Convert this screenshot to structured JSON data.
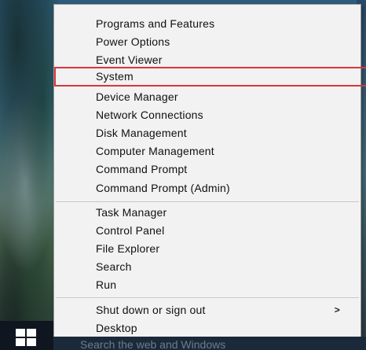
{
  "menu": {
    "items": [
      {
        "label": "Programs and Features"
      },
      {
        "label": "Power Options"
      },
      {
        "label": "Event Viewer"
      },
      {
        "label": "System"
      },
      {
        "label": "Device Manager"
      },
      {
        "label": "Network Connections"
      },
      {
        "label": "Disk Management"
      },
      {
        "label": "Computer Management"
      },
      {
        "label": "Command Prompt"
      },
      {
        "label": "Command Prompt (Admin)"
      },
      {
        "label": "Task Manager"
      },
      {
        "label": "Control Panel"
      },
      {
        "label": "File Explorer"
      },
      {
        "label": "Search"
      },
      {
        "label": "Run"
      },
      {
        "label": "Shut down or sign out"
      },
      {
        "label": "Desktop"
      }
    ],
    "submenu_indicator": ">",
    "highlighted_item": "System",
    "highlight_color": "#d9363e"
  },
  "taskbar": {
    "start_icon": "windows-logo-icon",
    "search_hint": "Search the web and Windows"
  }
}
